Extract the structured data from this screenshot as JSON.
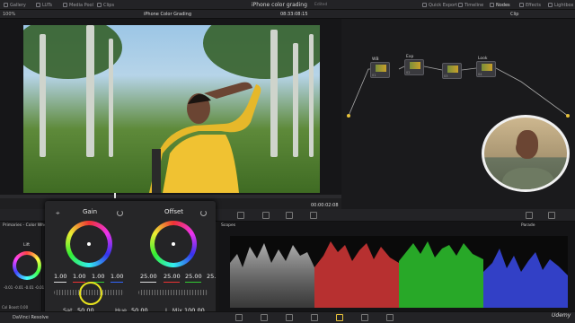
{
  "topbar": {
    "items": [
      "Gallery",
      "LUTs",
      "Media Pool",
      "Clips"
    ],
    "project_name": "iPhone color grading",
    "project_status": "Edited",
    "right_items": [
      "Quick Export",
      "Timeline",
      "Nodes",
      "Effects",
      "Lightbox"
    ]
  },
  "viewer": {
    "zoom": "100%",
    "clip_title": "iPhone Color Grading",
    "timecode_top": "08:33:08:15",
    "timecode_bottom": "00:00:02:08"
  },
  "nodes": {
    "mode": "Clip",
    "items": [
      {
        "label": "WB",
        "num": "01"
      },
      {
        "label": "Exp",
        "num": "02"
      },
      {
        "label": "",
        "num": "03"
      },
      {
        "label": "Look",
        "num": "04"
      }
    ]
  },
  "left_panel": {
    "title": "Primaries - Color Whe",
    "lift_label": "Lift",
    "lift_values": "-0.01  -0.01  -0.01  -0.01",
    "contrast_label": "Col Boost",
    "contrast_value": "0.00"
  },
  "wheels": {
    "gain": {
      "label": "Gain",
      "values": [
        "1.00",
        "1.00",
        "1.00",
        "1.00"
      ]
    },
    "offset": {
      "label": "Offset",
      "values": [
        "25.00",
        "25.00",
        "25.00",
        "25.00"
      ]
    },
    "sat": {
      "label": "Sat",
      "value": "50.00"
    },
    "hue": {
      "label": "Hue",
      "value": "50.00"
    },
    "lmix": {
      "label": "L. Mix",
      "value": "100.00"
    }
  },
  "scopes": {
    "title": "Scopes",
    "mode": "Parade"
  },
  "footer": {
    "app_name": "DaVinci Resolve",
    "watermark": "Udemy"
  },
  "colors": {
    "background": "#1c1c1e",
    "panel": "#232326",
    "cursor_ring": "#e8e31e",
    "jacket": "#e6b82a"
  }
}
